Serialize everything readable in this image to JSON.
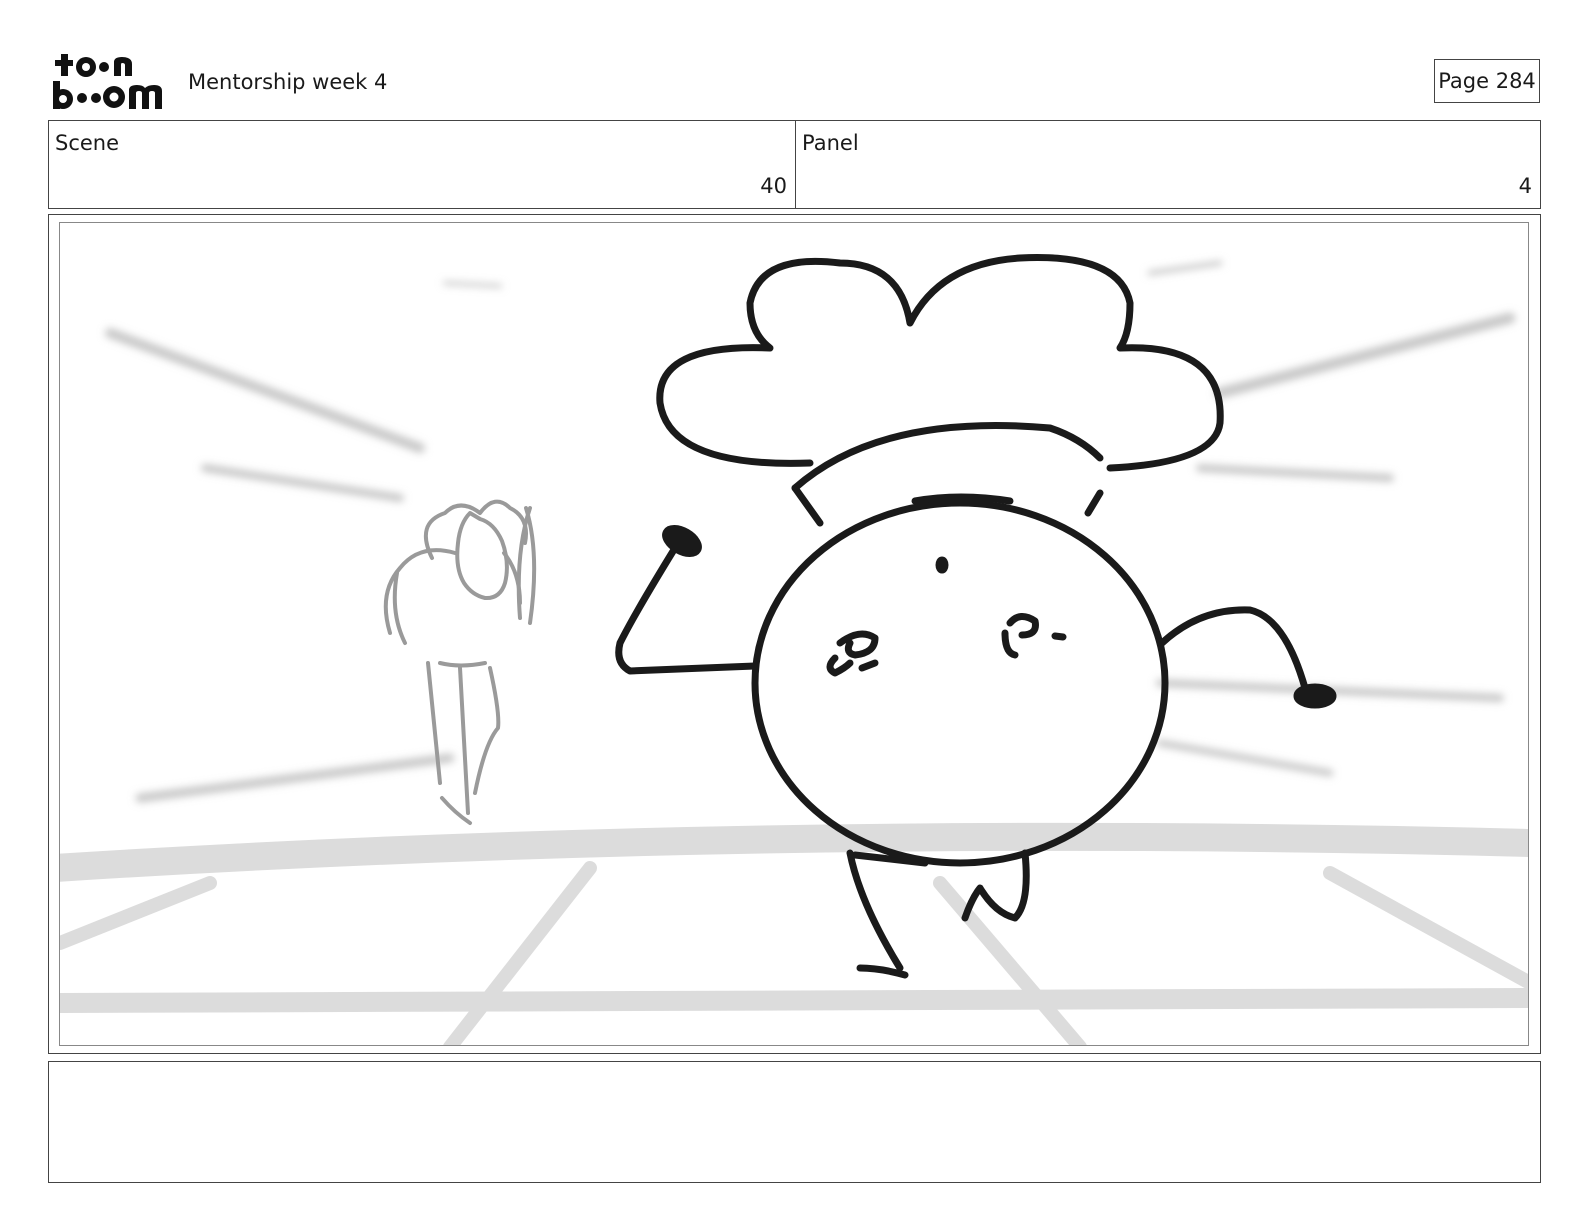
{
  "header": {
    "logo_text_top": "toon",
    "logo_text_bottom": "boom",
    "project_title": "Mentorship week 4",
    "page_label": "Page 284"
  },
  "scene": {
    "label": "Scene",
    "value": "40"
  },
  "panel": {
    "label": "Panel",
    "value": "4"
  },
  "drawing": {
    "description_icon": "storyboard-sketch",
    "colors": {
      "ink": "#1a1a1a",
      "pencil": "#9a9a9a",
      "floor": "#dcdcdc"
    }
  },
  "notes": {
    "text": ""
  }
}
